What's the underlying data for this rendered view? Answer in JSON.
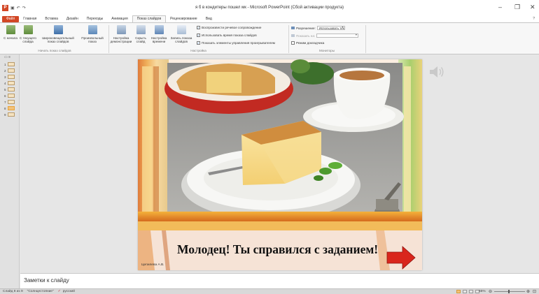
{
  "window": {
    "title": "я б в кондитеры пошел мк - Microsoft PowerPoint (Сбой активации продукта)",
    "minimize": "–",
    "maximize": "❐",
    "close": "✕"
  },
  "qat": {
    "undo": "↶",
    "redo": "↷",
    "save": "▣"
  },
  "tabs": [
    "Файл",
    "Главная",
    "Вставка",
    "Дизайн",
    "Переходы",
    "Анимация",
    "Показ слайдов",
    "Рецензирование",
    "Вид"
  ],
  "ribbon": {
    "groups": {
      "start": "Начать показ слайдов",
      "setup": "Настройка",
      "monitors": "Мониторы"
    },
    "buttons": {
      "from_start": "С начала",
      "from_current": "С текущего слайда",
      "broadcast": "Широковещательный показ слайдов",
      "custom": "Произвольный показ",
      "setup_show": "Настройка демонстрации",
      "hide_slide": "Скрыть слайд",
      "rehearse": "Настройка времени",
      "record": "Запись показа слайдов"
    },
    "checks": {
      "narration": "Воспроизвести речевое сопровождение",
      "timings": "Использовать время показа слайдов",
      "media_controls": "Показать элементы управления проигрывателем"
    },
    "monitors": {
      "resolution_label": "Разрешение:",
      "resolution_value": "Использовать тек...",
      "show_on_label": "Показать на:",
      "presenter_view": "Режим докладчика"
    }
  },
  "thumbnails": [
    "1",
    "2",
    "3",
    "4",
    "5",
    "6",
    "7",
    "8",
    "9"
  ],
  "selected_slide": 8,
  "slide": {
    "message": "Молодец! Ты справился с заданием!",
    "author": "Цепилева А.В."
  },
  "notes": {
    "placeholder": "Заметки к слайду"
  },
  "status": {
    "slide_info": "Слайд 8 из 9",
    "theme": "\"Солнцестояние\"",
    "language": "русский",
    "zoom": "65%"
  },
  "colors": {
    "file_tab": "#d24726",
    "accent_orange": "#e8a33a",
    "slide_banner": "#f6e3d6"
  }
}
